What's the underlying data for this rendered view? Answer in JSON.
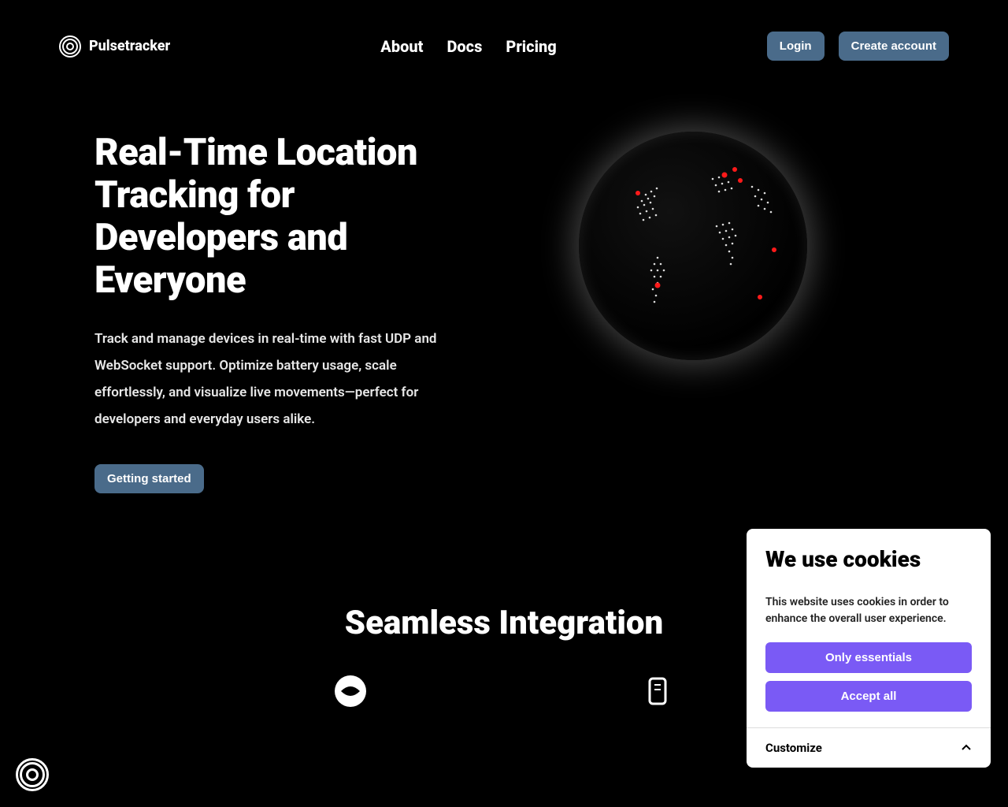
{
  "brand": "Pulsetracker",
  "nav": {
    "about": "About",
    "docs": "Docs",
    "pricing": "Pricing"
  },
  "auth": {
    "login": "Login",
    "create": "Create account"
  },
  "hero": {
    "title": "Real-Time Location Tracking for Developers and Everyone",
    "subtitle": "Track and manage devices in real-time with fast UDP and WebSocket support. Optimize battery usage, scale effortlessly, and visualize live movements—perfect for developers and everyday users alike.",
    "cta": "Getting started"
  },
  "section": {
    "integration_title": "Seamless Integration"
  },
  "cookies": {
    "title": "We use cookies",
    "text": "This website uses cookies in order to enhance the overall user experience.",
    "only_essentials": "Only essentials",
    "accept_all": "Accept all",
    "customize": "Customize"
  }
}
